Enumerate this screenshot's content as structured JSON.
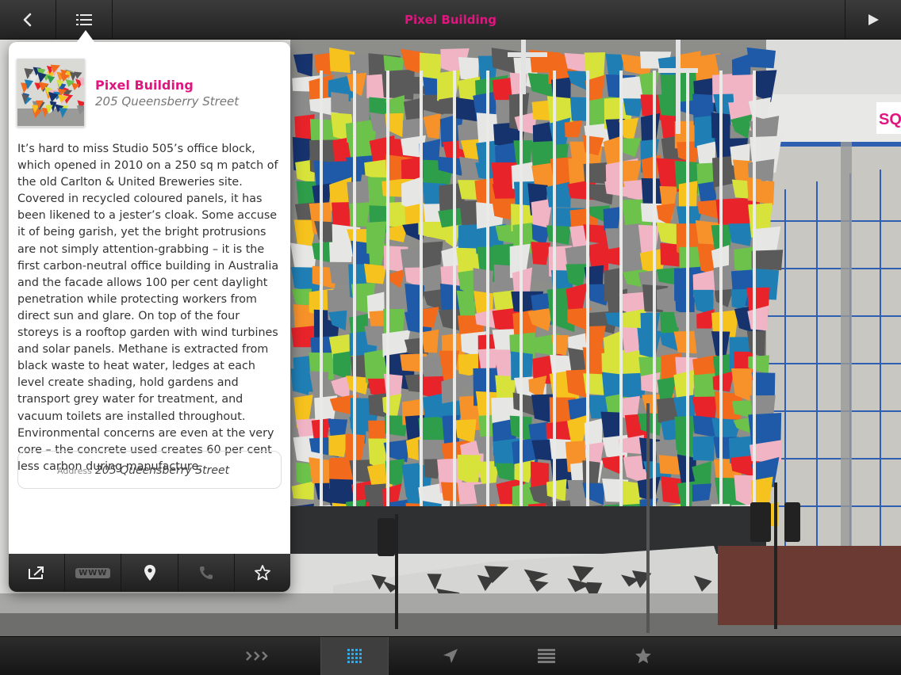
{
  "header": {
    "title": "Pixel Building",
    "back_icon": "chevron-left-icon",
    "list_icon": "list-icon",
    "play_icon": "play-icon"
  },
  "popover": {
    "title": "Pixel Building",
    "subtitle": "205 Queensberry Street",
    "description": "It’s hard to miss Studio 505’s office block, which opened in 2010 on a 250 sq m patch of the old Carlton & United Breweries site. Covered in recycled coloured panels, it has been likened to a jester’s cloak. Some accuse it of being garish, yet the bright protrusions are not simply attention-grabbing – it is the first carbon-neutral office building in Australia and the facade allows 100 per cent daylight penetration while protecting workers from direct sun and glare. On top of the four storeys is a rooftop garden with wind turbines and solar panels. Methane is extracted from black waste to heat water, ledges at each level create shading, hold gardens and transport grey water for treatment, and vacuum toilets are installed throughout. Environmental concerns are even at the very core – the concrete used creates 60 per cent less carbon during manufacture.",
    "address_label": "Address",
    "address_value": "205 Queensberry Street",
    "actions": {
      "share_icon": "share-icon",
      "www_label": "WWW",
      "map_icon": "map-pin-icon",
      "phone_icon": "phone-icon",
      "favorite_icon": "star-icon"
    }
  },
  "bottom_nav": {
    "items": [
      {
        "icon": "chevrons-right-icon",
        "active": false
      },
      {
        "icon": "grid-icon",
        "active": true
      },
      {
        "icon": "location-arrow-icon",
        "active": false
      },
      {
        "icon": "list-icon",
        "active": false
      },
      {
        "icon": "star-icon",
        "active": false
      }
    ]
  },
  "colors": {
    "accent": "#e0157f",
    "active_tab": "#35a9e6"
  }
}
